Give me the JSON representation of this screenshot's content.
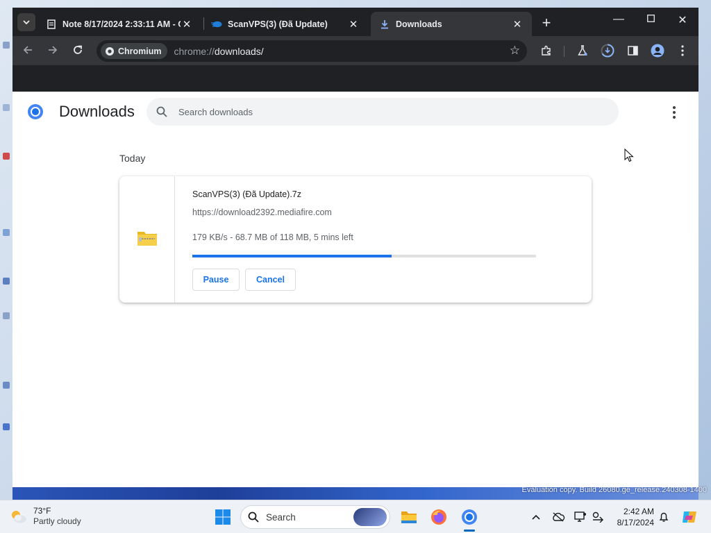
{
  "browser": {
    "tabs": [
      {
        "title": "Note 8/17/2024 2:33:11 AM - O",
        "active": false
      },
      {
        "title": "ScanVPS(3) (Đã Update)",
        "active": false
      },
      {
        "title": "Downloads",
        "active": true
      }
    ],
    "omnibox": {
      "chip_label": "Chromium",
      "url_scheme": "chrome://",
      "url_path": "downloads/"
    }
  },
  "page": {
    "title": "Downloads",
    "search_placeholder": "Search downloads",
    "section_date": "Today",
    "download": {
      "file_name": "ScanVPS(3) (Đã Update).7z",
      "source_url": "https://download2392.mediafire.com",
      "status": "179 KB/s - 68.7 MB of 118 MB, 5 mins left",
      "progress_fraction": 0.58,
      "pause_label": "Pause",
      "cancel_label": "Cancel"
    }
  },
  "desktop": {
    "watermark": "Evaluation copy. Build 26080.ge_release.240308-1400"
  },
  "taskbar": {
    "weather_temp": "73°F",
    "weather_desc": "Partly cloudy",
    "search_label": "Search",
    "time": "2:42 AM",
    "date": "8/17/2024"
  },
  "colors": {
    "accent": "#1a73e8",
    "titlebar": "#202124",
    "toolbar": "#35363a"
  }
}
